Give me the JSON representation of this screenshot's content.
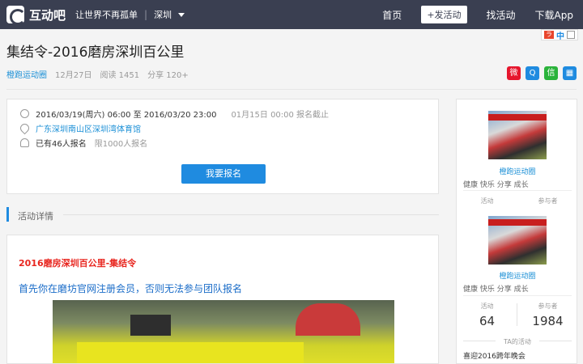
{
  "header": {
    "logo_text": "互动吧",
    "slogan": "让世界不再孤单",
    "city": "深圳",
    "nav": [
      "首页",
      "+发活动",
      "找活动",
      "下载App"
    ],
    "lang": "中"
  },
  "event": {
    "title": "集结令-2016磨房深圳百公里",
    "organizer": "橙跑运动圈",
    "date": "12月27日",
    "reads": "阅读 1451",
    "shares": "分享 120+",
    "time": "2016/03/19(周六) 06:00 至 2016/03/20 23:00",
    "deadline": "01月15日 00:00 报名截止",
    "location": "广东深圳南山区深圳湾体育馆",
    "enrolled": "已有46人报名",
    "limit": "限1000人报名",
    "signup_label": "我要报名"
  },
  "share_icons": [
    {
      "name": "weibo-icon",
      "color": "#e6162d"
    },
    {
      "name": "qq-icon",
      "color": "#1f8be0"
    },
    {
      "name": "wechat-icon",
      "color": "#2bb33b"
    },
    {
      "name": "qrcode-icon",
      "color": "#1f8be0"
    }
  ],
  "details": {
    "section_label": "活动详情",
    "headline": "2016磨房深圳百公里-集结令",
    "subline": "首先你在磨坊官网注册会员，否则无法参与团队报名"
  },
  "sidebar": {
    "org_name": "橙跑运动圈",
    "tags": "健康 快乐 分享 成长",
    "col_activity": "活动",
    "col_participants": "参与者",
    "activity_count": "64",
    "participant_count": "1984",
    "ta_label": "TA的活动",
    "ta_item": "喜迎2016跨年晚会"
  }
}
